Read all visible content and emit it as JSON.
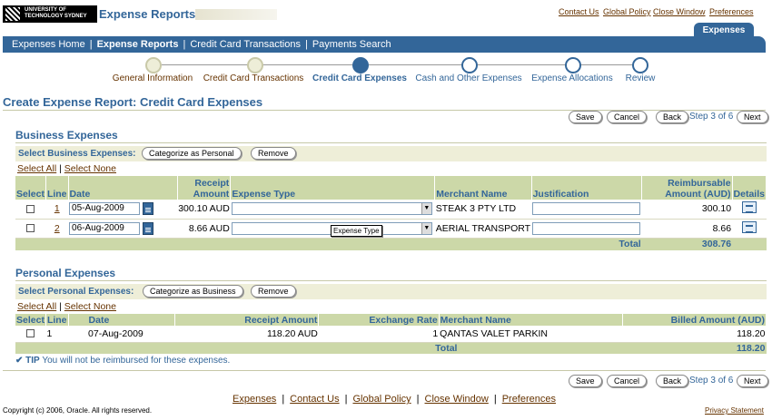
{
  "logo": {
    "line1": "UNIVERSITY OF",
    "line2": "TECHNOLOGY SYDNEY"
  },
  "app_title": "Expense Reports",
  "global_links": [
    "Contact Us",
    "Global Policy",
    "Close Window",
    "Preferences"
  ],
  "active_tab": "Expenses",
  "nav": {
    "items": [
      "Expenses Home",
      "Expense Reports",
      "Credit Card Transactions",
      "Payments Search"
    ],
    "sep": "|"
  },
  "train": {
    "steps": [
      "General Information",
      "Credit Card Transactions",
      "Credit Card Expenses",
      "Cash and Other Expenses",
      "Expense Allocations",
      "Review"
    ],
    "current_index": 2
  },
  "page_title": "Create Expense Report: Credit Card Expenses",
  "buttons": {
    "save": "Save",
    "cancel": "Cancel",
    "back": "Back",
    "next": "Next",
    "categorize_personal": "Categorize as Personal",
    "categorize_business": "Categorize as Business",
    "remove": "Remove"
  },
  "step_of": "Step 3 of 6",
  "business": {
    "heading": "Business Expenses",
    "select_label": "Select Business Expenses:",
    "select_all": "Select All",
    "select_none": "Select None",
    "sep": "|",
    "columns": {
      "select": "Select",
      "line": "Line",
      "date": "Date",
      "receipt": "Receipt Amount",
      "type": "Expense Type",
      "merchant": "Merchant Name",
      "justification": "Justification",
      "reimb": "Reimbursable Amount (AUD)",
      "details": "Details"
    },
    "rows": [
      {
        "line": "1",
        "date": "05-Aug-2009",
        "receipt": "300.10 AUD",
        "type": "",
        "merchant": "STEAK 3 PTY LTD",
        "justification": "",
        "reimb": "300.10"
      },
      {
        "line": "2",
        "date": "06-Aug-2009",
        "receipt": "8.66 AUD",
        "type": "",
        "merchant": "AERIAL TRANSPORT",
        "justification": "",
        "reimb": "8.66"
      }
    ],
    "total_label": "Total",
    "total": "308.76",
    "tooltip": "Expense Type"
  },
  "personal": {
    "heading": "Personal Expenses",
    "select_label": "Select Personal Expenses:",
    "select_all": "Select All",
    "select_none": "Select None",
    "sep": "|",
    "columns": {
      "select": "Select",
      "line": "Line",
      "date": "Date",
      "receipt": "Receipt Amount",
      "rate": "Exchange Rate",
      "merchant": "Merchant Name",
      "billed": "Billed Amount (AUD)"
    },
    "rows": [
      {
        "line": "1",
        "date": "07-Aug-2009",
        "receipt": "118.20 AUD",
        "rate": "1",
        "merchant": "QANTAS VALET PARKIN",
        "billed": "118.20"
      }
    ],
    "total_label": "Total",
    "total": "118.20"
  },
  "tip": {
    "label": "TIP",
    "text": "You will not be reimbursed for these expenses."
  },
  "footer": {
    "links": [
      "Expenses",
      "Contact Us",
      "Global Policy",
      "Close Window",
      "Preferences"
    ],
    "copyright": "Copyright (c) 2006, Oracle. All rights reserved.",
    "privacy": "Privacy Statement"
  }
}
